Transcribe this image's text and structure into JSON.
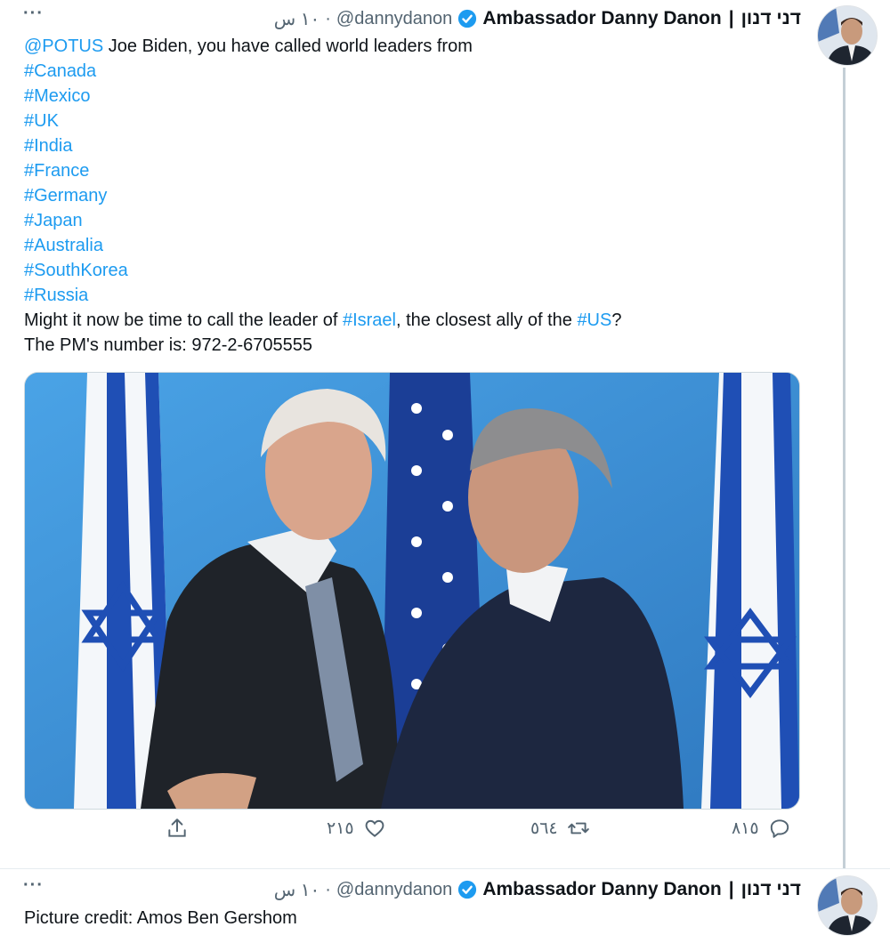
{
  "tweets": [
    {
      "author": {
        "name_he": "דני דנון",
        "separator": "|",
        "name_en": "Ambassador Danny Danon",
        "verified": true,
        "handle": "@dannydanon",
        "dot": "·",
        "time": "١٠ س"
      },
      "more_label": "···",
      "lines": [
        {
          "mention": "@POTUS",
          "text": " Joe Biden, you have called world leaders from"
        },
        {
          "hashtag": "#Canada"
        },
        {
          "hashtag": "#Mexico"
        },
        {
          "hashtag": "#UK"
        },
        {
          "hashtag": "#India"
        },
        {
          "hashtag": "#France"
        },
        {
          "hashtag": "#Germany"
        },
        {
          "hashtag": "#Japan"
        },
        {
          "hashtag": "#Australia"
        },
        {
          "hashtag": "#SouthKorea"
        },
        {
          "hashtag": "#Russia"
        },
        {
          "part1": "Might it now be time to call the leader of ",
          "tag1": "#Israel",
          "part2": ", the closest ally of the ",
          "tag2": "#US",
          "part3": "?"
        },
        {
          "text": "The PM's number is: 972-2-6705555"
        }
      ],
      "media_alt": "Photo of two men greeting in front of Israeli and US flags",
      "actions": {
        "reply_count": "٨١٥",
        "retweet_count": "٥٦٤",
        "like_count": "٢١٥",
        "share_label": ""
      }
    },
    {
      "author": {
        "name_he": "דני דנון",
        "separator": "|",
        "name_en": "Ambassador Danny Danon",
        "verified": true,
        "handle": "@dannydanon",
        "dot": "·",
        "time": "١٠ س"
      },
      "more_label": "···",
      "text": "Picture credit: Amos Ben Gershom"
    }
  ],
  "colors": {
    "link": "#1d9bf0",
    "muted": "#536471",
    "text": "#0f1419",
    "verified": "#1d9bf0"
  },
  "icons": [
    "reply-icon",
    "retweet-icon",
    "like-icon",
    "share-icon",
    "verified-badge-icon",
    "more-icon"
  ]
}
